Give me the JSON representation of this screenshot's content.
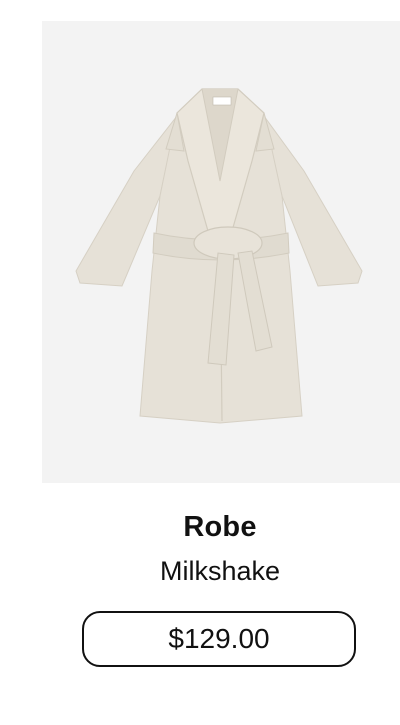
{
  "product": {
    "name": "Robe",
    "color": "Milkshake",
    "price": "$129.00",
    "image_icon": "robe-product-image",
    "colors": {
      "image_background": "#f3f3f3",
      "robe": "#e6e1d7",
      "robe_shadow": "#d6d0c4",
      "outline": "#111111"
    }
  }
}
